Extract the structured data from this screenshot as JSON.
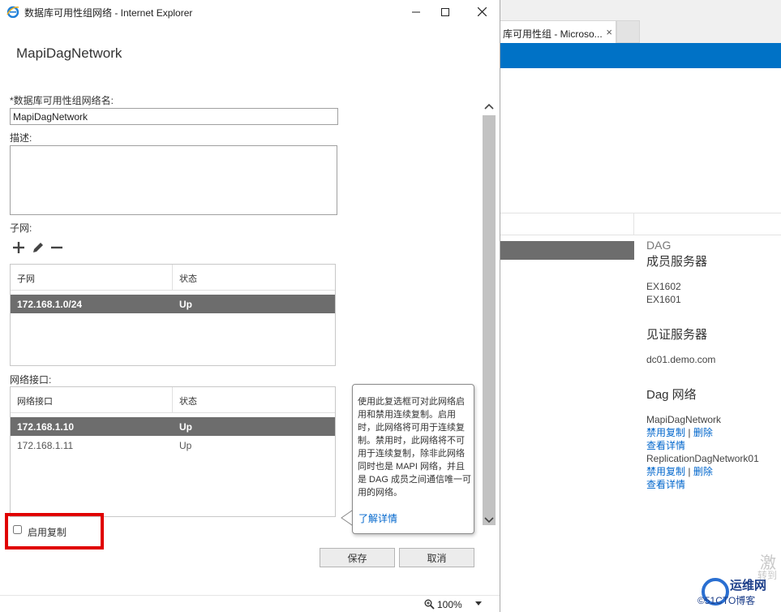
{
  "window": {
    "title": "数据库可用性组网络 - Internet Explorer",
    "dialog_title": "MapiDagNetwork"
  },
  "form": {
    "name_label": "*数据库可用性组网络名:",
    "name_value": "MapiDagNetwork",
    "description_label": "描述:",
    "description_value": "",
    "subnet_label": "子网:",
    "subnet_columns": [
      "子网",
      "状态"
    ],
    "subnets": [
      {
        "subnet": "172.168.1.0/24",
        "status": "Up",
        "selected": true
      }
    ],
    "nic_label": "网络接口:",
    "nic_columns": [
      "网络接口",
      "状态"
    ],
    "nics": [
      {
        "ip": "172.168.1.10",
        "status": "Up",
        "selected": true
      },
      {
        "ip": "172.168.1.11",
        "status": "Up",
        "selected": false
      }
    ],
    "replication_label": "启用复制",
    "replication_checked": false,
    "save_label": "保存",
    "cancel_label": "取消"
  },
  "callout": {
    "text": "使用此复选框可对此网络启用和禁用连续复制。启用时，此网络将可用于连续复制。禁用时，此网络将不可用于连续复制，除非此网络同时也是 MAPI 网络，并且是 DAG 成员之间通信唯一可用的网络。",
    "link": "了解详情"
  },
  "statusbar": {
    "zoom": "100%"
  },
  "background": {
    "tab_title": "库可用性组 - Microso...",
    "tab_close": "×",
    "detail": {
      "dag_label": "DAG",
      "members_title": "成员服务器",
      "members": [
        "EX1602",
        "EX1601"
      ],
      "witness_title": "见证服务器",
      "witness": "dc01.demo.com",
      "networks_title": "Dag 网络",
      "networks": [
        {
          "name": "MapiDagNetwork",
          "disable": "禁用复制",
          "sep": "|",
          "delete": "删除",
          "details": "查看详情"
        },
        {
          "name": "ReplicationDagNetwork01",
          "disable": "禁用复制",
          "sep": "|",
          "delete": "删除",
          "details": "查看详情"
        }
      ]
    },
    "activate_text": "激",
    "activate_sub": "转到",
    "watermark_site": "运维网",
    "watermark_blog": "©51CTO博客"
  },
  "colors": {
    "accent": "#0072c6",
    "selection": "#6d6d6d",
    "highlight_box": "#e00000",
    "link": "#0066cc"
  }
}
